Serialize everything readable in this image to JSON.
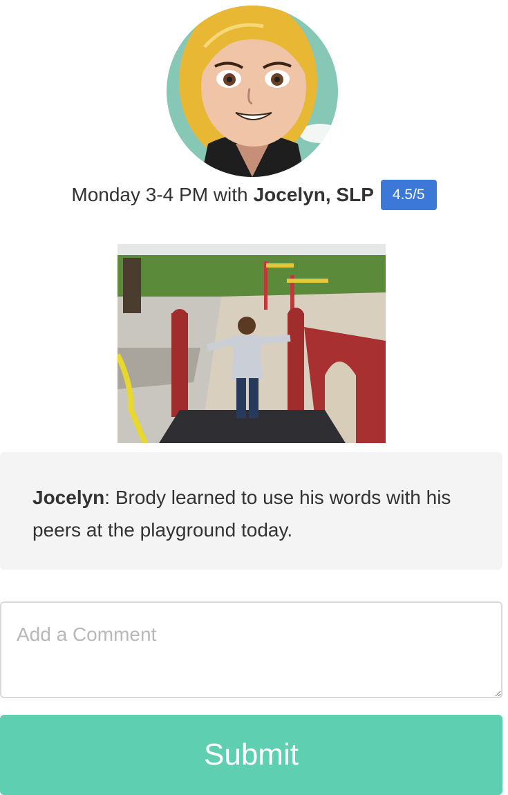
{
  "session": {
    "text": "Monday 3-4 PM with",
    "therapist": "Jocelyn, SLP",
    "rating": "4.5/5"
  },
  "avatar": {
    "subject": "cartoon avatar of a blonde woman"
  },
  "photo": {
    "subject": "child standing on a playground structure"
  },
  "note": {
    "author": "Jocelyn",
    "separator": ":",
    "message": " Brody learned to use his words with his peers at the playground today."
  },
  "comment": {
    "placeholder": "Add a Comment",
    "value": ""
  },
  "submit": {
    "label": "Submit"
  },
  "colors": {
    "badge": "#3c78d8",
    "submit": "#5ecfb1",
    "note_background": "#f4f4f4"
  }
}
